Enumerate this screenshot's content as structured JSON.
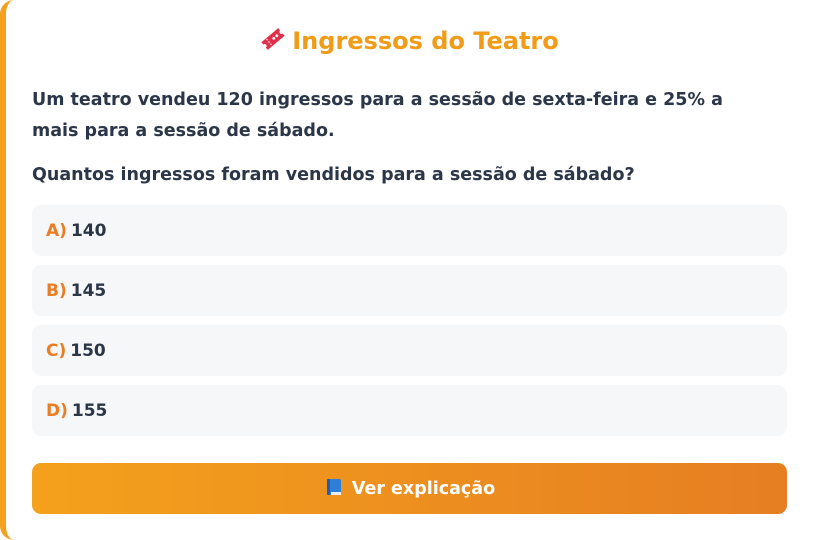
{
  "quiz": {
    "title": "Ingressos do Teatro",
    "statement": "Um teatro vendeu 120 ingressos para a sessão de sexta-feira e 25% a mais para a sessão de sábado.",
    "question": "Quantos ingressos foram vendidos para a sessão de sábado?",
    "options": [
      {
        "letter": "A)",
        "text": "140"
      },
      {
        "letter": "B)",
        "text": "145"
      },
      {
        "letter": "C)",
        "text": "150"
      },
      {
        "letter": "D)",
        "text": "155"
      }
    ],
    "explain_button": "Ver explicação",
    "icons": {
      "title": "ticket-icon",
      "button": "book-icon"
    },
    "colors": {
      "accent": "#f29b17",
      "letters": "#ec7c22",
      "text": "#2b3648",
      "option_bg": "#f6f7f9"
    }
  }
}
